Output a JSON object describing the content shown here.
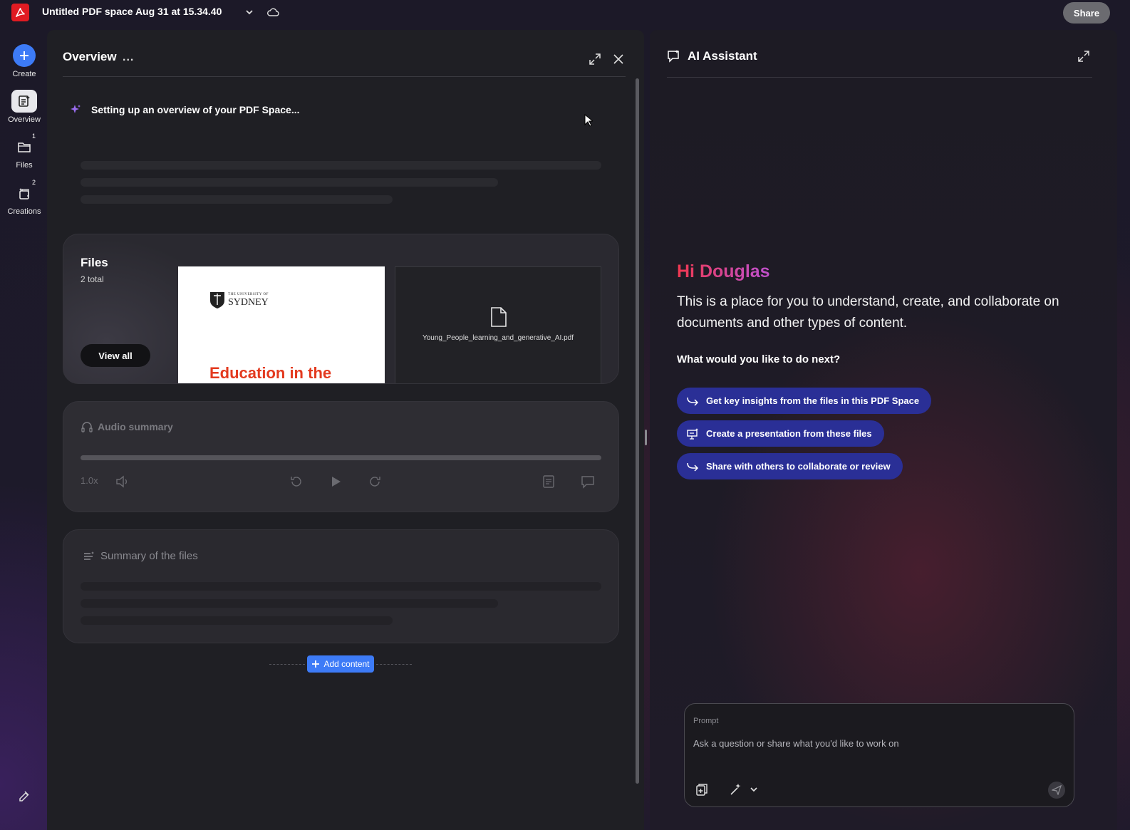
{
  "topbar": {
    "title": "Untitled PDF space Aug 31 at 15.34.40",
    "share_label": "Share"
  },
  "rail": {
    "create_label": "Create",
    "overview_label": "Overview",
    "files_label": "Files",
    "files_badge": "1",
    "creations_label": "Creations",
    "creations_badge": "2"
  },
  "overview": {
    "title": "Overview",
    "more": "...",
    "setup_text": "Setting up an overview of your PDF Space...",
    "files": {
      "title": "Files",
      "count": "2 total",
      "view_all": "View all",
      "thumb1": {
        "university_small": "THE UNIVERSITY OF",
        "university_big": "SYDNEY",
        "heading": "Education in the"
      },
      "thumb2": {
        "filename": "Young_People_learning_and_generative_AI.pdf"
      }
    },
    "audio": {
      "title": "Audio summary",
      "speed": "1.0x"
    },
    "summary": {
      "title": "Summary of the files"
    },
    "add_content": "Add content"
  },
  "assistant": {
    "title": "AI Assistant",
    "greeting": "Hi Douglas",
    "intro": "This is a place for you to understand, create, and collaborate on documents and other types of content.",
    "question": "What would you like to do next?",
    "suggestions": [
      "Get key insights from the files in this PDF Space",
      "Create a presentation from these files",
      "Share with others to collaborate or review"
    ],
    "prompt": {
      "label": "Prompt",
      "placeholder": "Ask a question or share what you'd like to work on"
    }
  },
  "colors": {
    "accent_blue": "#3d7bf7",
    "suggestion_bg": "#2a2f96",
    "brand_red": "#e01b22",
    "thumb_heading": "#e33a1f"
  }
}
